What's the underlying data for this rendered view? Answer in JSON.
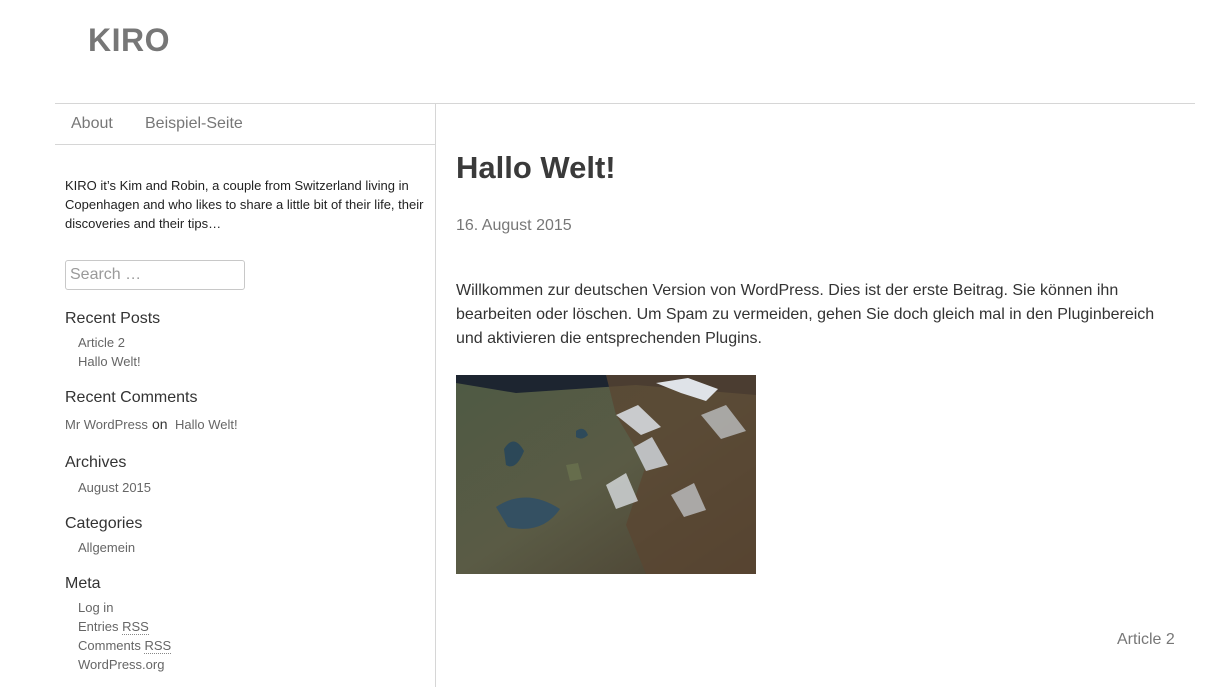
{
  "site": {
    "title": "KIRO"
  },
  "nav": {
    "items": [
      "About",
      "Beispiel-Seite"
    ]
  },
  "sidebar": {
    "intro": "KIRO it’s Kim and Robin, a couple from Switzerland living in Copenhagen and who likes to share a little bit of their life, their discoveries and their tips…",
    "search": {
      "placeholder": "Search …",
      "value": ""
    },
    "recent_posts": {
      "title": "Recent Posts",
      "items": [
        "Article 2",
        "Hallo Welt!"
      ]
    },
    "recent_comments": {
      "title": "Recent Comments",
      "author": "Mr WordPress",
      "connector": "on",
      "post": "Hallo Welt!"
    },
    "archives": {
      "title": "Archives",
      "items": [
        "August 2015"
      ]
    },
    "categories": {
      "title": "Categories",
      "items": [
        "Allgemein"
      ]
    },
    "meta": {
      "title": "Meta",
      "login": "Log in",
      "entries": "Entries",
      "comments": "Comments",
      "rss": "RSS",
      "wordpress": "WordPress.org"
    }
  },
  "post": {
    "title": "Hallo Welt!",
    "date": "16. August 2015",
    "body": "Willkommen zur deutschen Version von WordPress. Dies ist der erste Beitrag. Sie können ihn bearbeiten oder löschen. Um Spam zu vermeiden, gehen Sie doch gleich mal in den Pluginbereich und aktivieren die entsprechenden Plugins."
  },
  "pagination": {
    "next": "Article 2"
  }
}
